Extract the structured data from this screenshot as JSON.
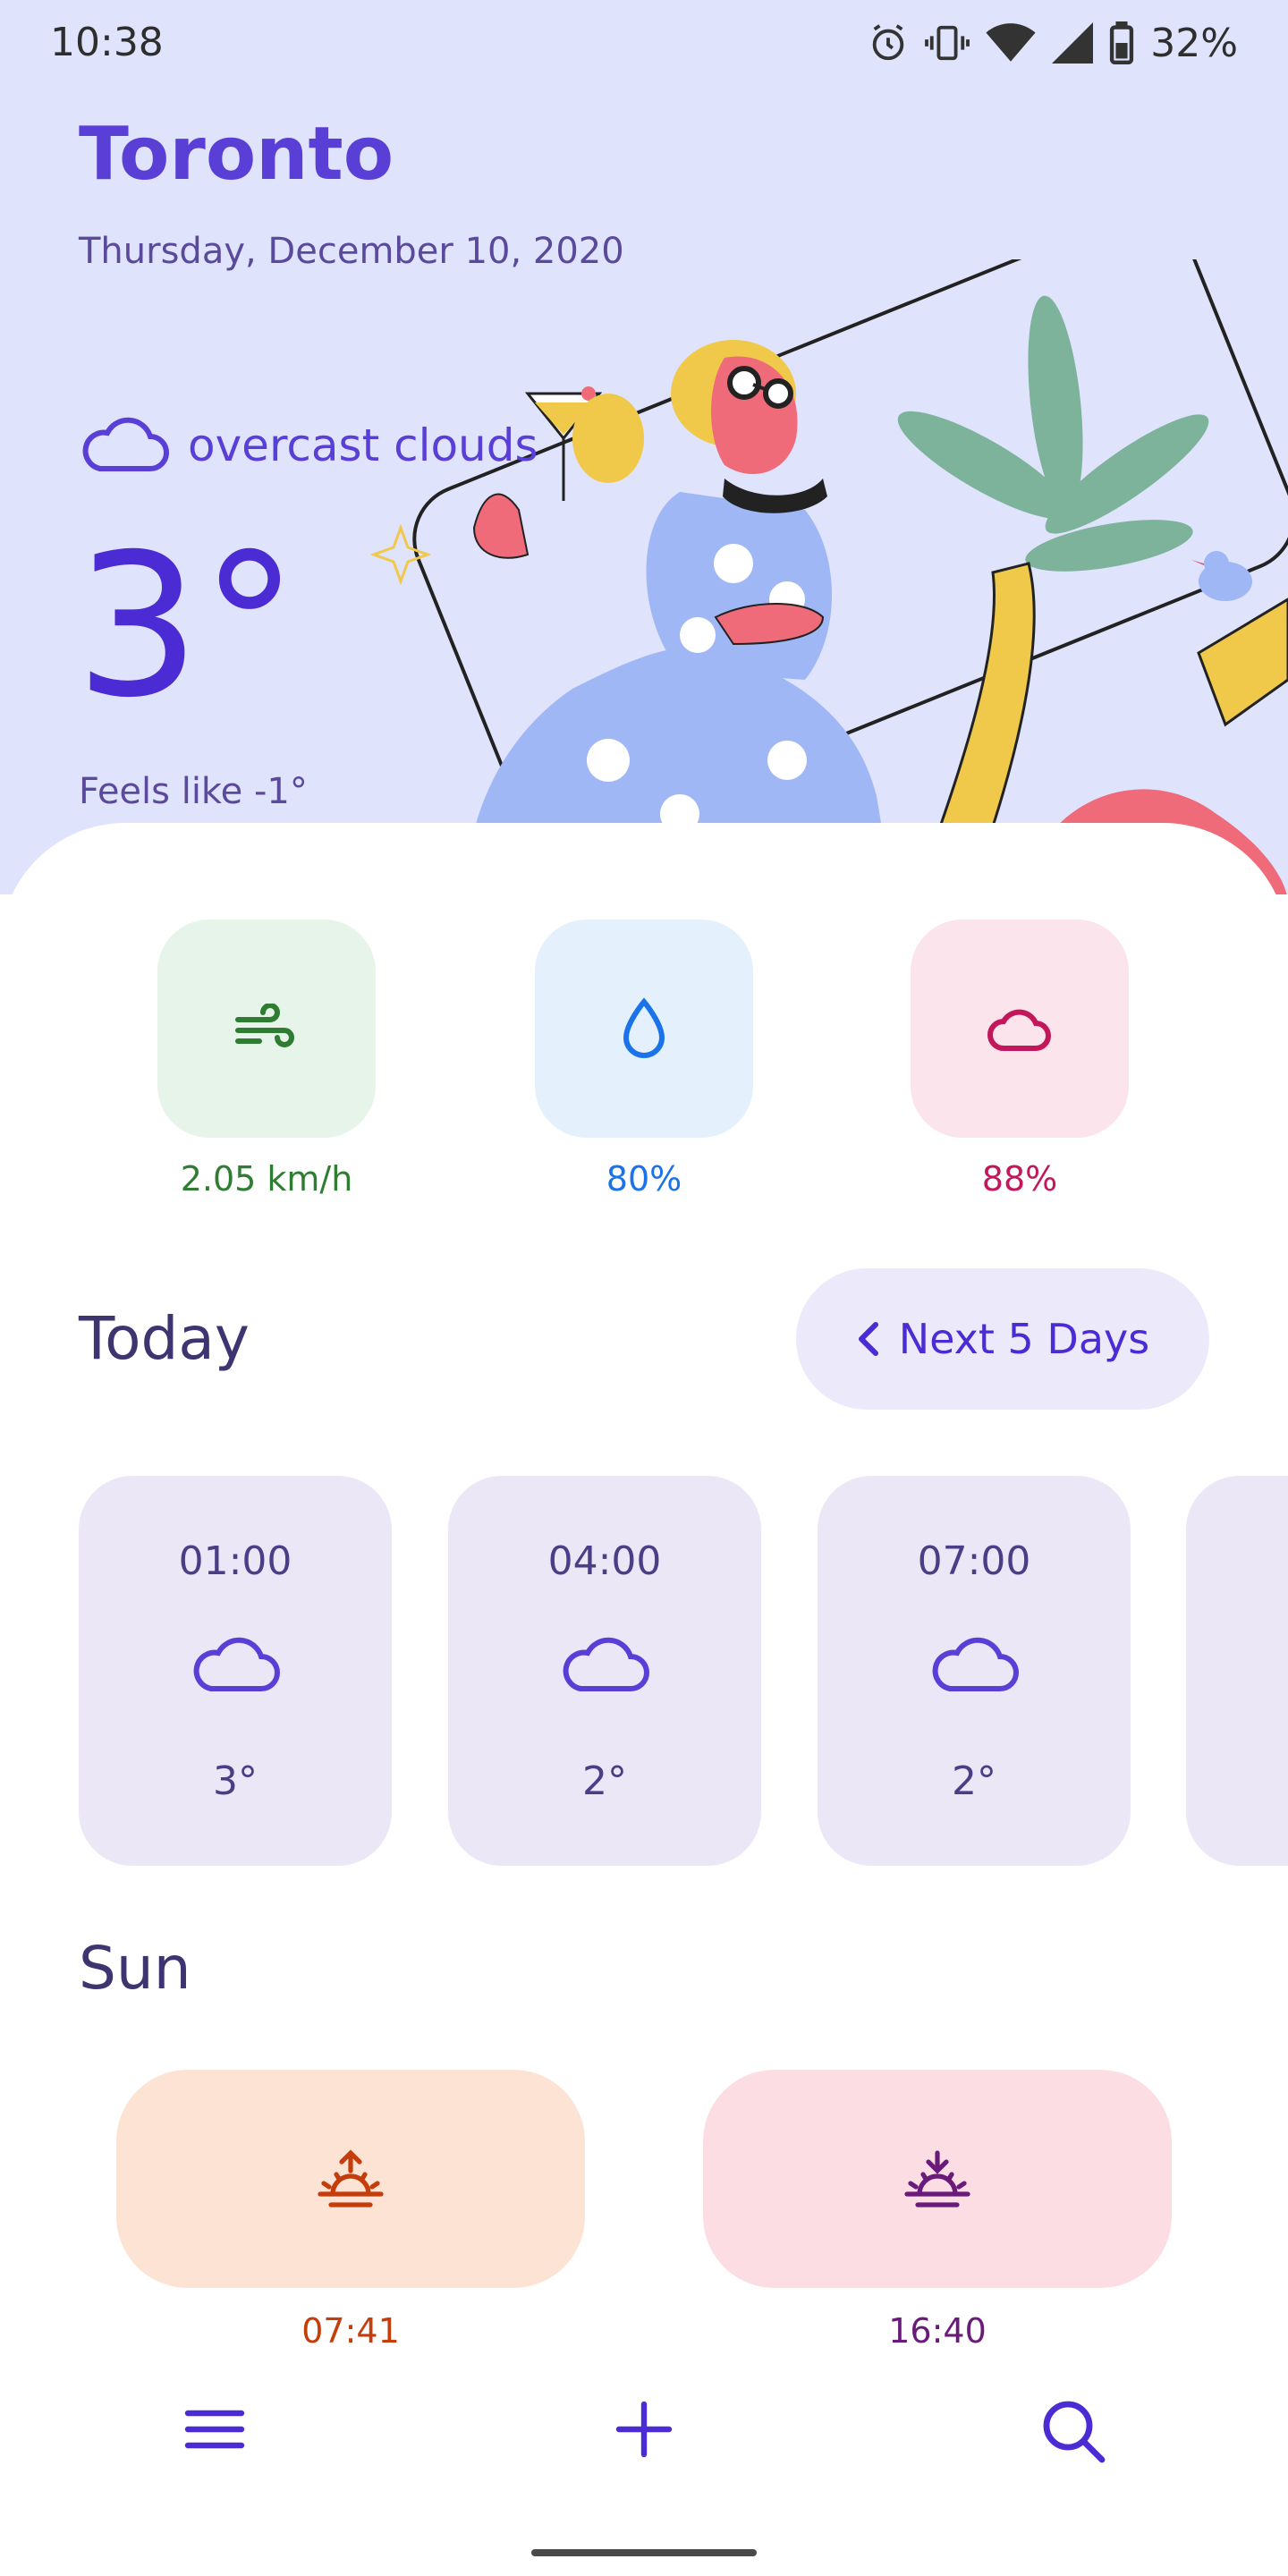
{
  "status_bar": {
    "time": "10:38",
    "battery": "32%",
    "icons": [
      "alarm-icon",
      "vibrate-icon",
      "wifi-icon",
      "signal-icon",
      "battery-icon"
    ]
  },
  "header": {
    "city": "Toronto",
    "date": "Thursday, December 10, 2020",
    "condition": "overcast clouds",
    "condition_icon": "cloud-icon",
    "temperature": "3°",
    "feels_like": "Feels like -1°"
  },
  "metrics": [
    {
      "icon": "wind-icon",
      "value": "2.05 km/h",
      "color": "#2e7d32",
      "bg": "#e6f4ea"
    },
    {
      "icon": "humidity-drop-icon",
      "value": "80%",
      "color": "#1a73e8",
      "bg": "#e5f0fd"
    },
    {
      "icon": "cloud-icon",
      "value": "88%",
      "color": "#c2185b",
      "bg": "#fbe4ec"
    }
  ],
  "today": {
    "title": "Today",
    "next_button": "Next 5 Days",
    "hours": [
      {
        "time": "01:00",
        "icon": "cloud-icon",
        "temp": "3°"
      },
      {
        "time": "04:00",
        "icon": "cloud-icon",
        "temp": "2°"
      },
      {
        "time": "07:00",
        "icon": "cloud-icon",
        "temp": "2°"
      }
    ]
  },
  "sun": {
    "title": "Sun",
    "sunrise": {
      "icon": "sunrise-icon",
      "time": "07:41",
      "color": "#c43d0b",
      "bg": "#fde3d4"
    },
    "sunset": {
      "icon": "sunset-icon",
      "time": "16:40",
      "color": "#6a1b7a",
      "bg": "#fcdde4"
    }
  },
  "nav": {
    "icons": [
      "menu-icon",
      "add-icon",
      "search-icon"
    ],
    "accent": "#4b2bd3"
  }
}
